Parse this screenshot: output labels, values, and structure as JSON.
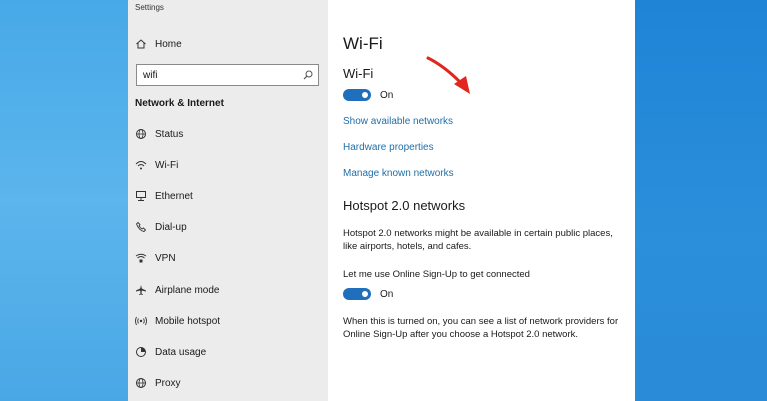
{
  "window": {
    "title": "Settings"
  },
  "sidebar": {
    "home_label": "Home",
    "search": {
      "value": "wifi",
      "placeholder": ""
    },
    "section_heading": "Network & Internet",
    "items": [
      {
        "label": "Status",
        "icon": "globe-icon"
      },
      {
        "label": "Wi-Fi",
        "icon": "wifi-icon"
      },
      {
        "label": "Ethernet",
        "icon": "ethernet-icon"
      },
      {
        "label": "Dial-up",
        "icon": "phone-icon"
      },
      {
        "label": "VPN",
        "icon": "vpn-icon"
      },
      {
        "label": "Airplane mode",
        "icon": "airplane-icon"
      },
      {
        "label": "Mobile hotspot",
        "icon": "hotspot-icon"
      },
      {
        "label": "Data usage",
        "icon": "data-usage-icon"
      },
      {
        "label": "Proxy",
        "icon": "proxy-globe-icon"
      }
    ]
  },
  "main": {
    "title": "Wi-Fi",
    "wifi_heading": "Wi-Fi",
    "wifi_toggle": {
      "state": "On",
      "on": true
    },
    "links": {
      "show_networks": "Show available networks",
      "hardware_properties": "Hardware properties",
      "manage_networks": "Manage known networks"
    },
    "hotspot_heading": "Hotspot 2.0 networks",
    "hotspot_description": "Hotspot 2.0 networks might be available in certain public places, like airports, hotels, and cafes.",
    "online_signup_label": "Let me use Online Sign-Up to get connected",
    "online_signup_toggle": {
      "state": "On",
      "on": true
    },
    "signup_note": "When this is turned on, you can see a list of network providers for Online Sign-Up after you choose a Hotspot 2.0 network."
  },
  "colors": {
    "accent": "#1f6fbd",
    "link": "#1f6fa8",
    "annotation_arrow": "#e0261f",
    "sidebar_bg": "#ececec",
    "desktop_blue": "#3a9ee0"
  }
}
